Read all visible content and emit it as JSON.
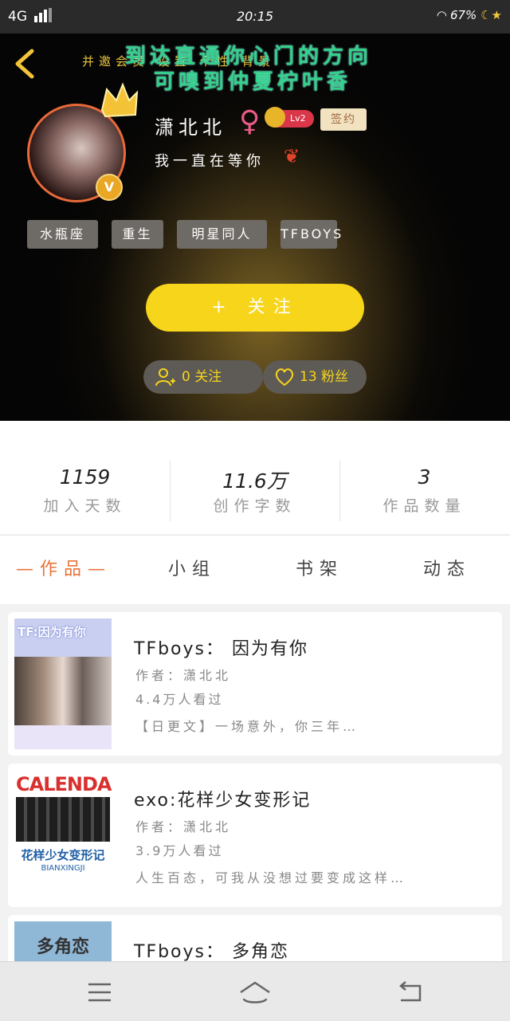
{
  "status": {
    "network": "4G",
    "time": "20:15",
    "battery": "67%"
  },
  "header": {
    "banner_line1": "到达直通你心门的方向",
    "banner_line2": "可嗅到仲夏柠叶香",
    "banner_sub": "并邀会员 设置 个性 背景",
    "username": "潇北北",
    "level": "Lv2",
    "sign_label": "签约",
    "bio": "我一直在等你",
    "vip_mark": "V",
    "tags": [
      "水瓶座",
      "重生",
      "明星同人",
      "TFBOYS"
    ],
    "follow_label": "关注",
    "follow_plus": "+",
    "following_label": "0 关注",
    "fans_label": "13 粉丝"
  },
  "stats": [
    {
      "value": "1159",
      "label": "加入天数"
    },
    {
      "value": "11.6万",
      "label": "创作字数"
    },
    {
      "value": "3",
      "label": "作品数量"
    }
  ],
  "tabs": [
    {
      "label": "作品",
      "active": true
    },
    {
      "label": "小组",
      "active": false
    },
    {
      "label": "书架",
      "active": false
    },
    {
      "label": "动态",
      "active": false
    }
  ],
  "works": [
    {
      "title": "TFboys： 因为有你",
      "author": "作者：潇北北",
      "views": "4.4万人看过",
      "desc": "【日更文】一场意外，你三年…",
      "cover_text": "TF:因为有你",
      "cover_color": "#c9cff0"
    },
    {
      "title": "exo:花样少女变形记",
      "author": "作者：潇北北",
      "views": "3.9万人看过",
      "desc": "人生百态，可我从没想过要变成这样…",
      "cover_text": "CALENDAR",
      "cover_sub": "花样少女变形记",
      "cover_sub2": "BIANXINGJI",
      "cover_color": "#ffffff"
    },
    {
      "title": "TFboys： 多角恋",
      "cover_text": "多角恋",
      "cover_color": "#8fb7d6"
    }
  ],
  "colors": {
    "accent": "#f6d51a",
    "active_tab": "#e8743b"
  }
}
